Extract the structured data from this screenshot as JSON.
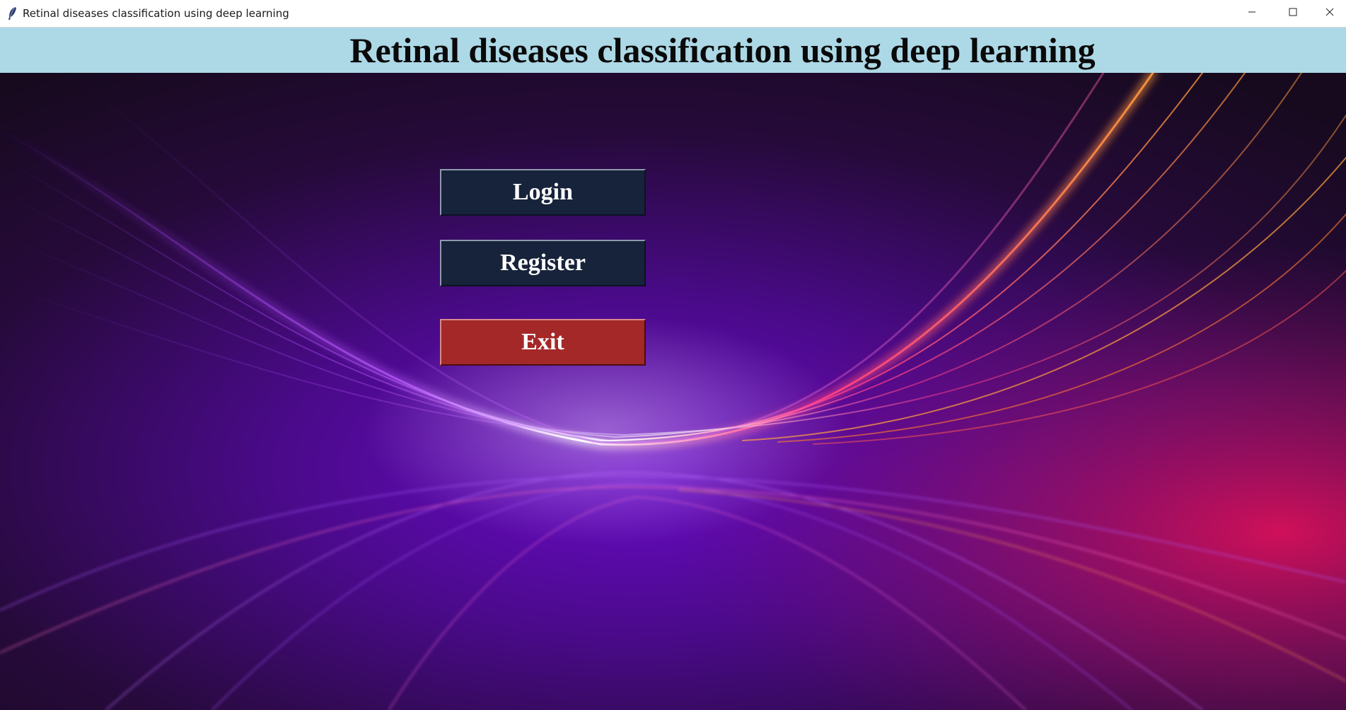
{
  "window": {
    "title": "Retinal diseases classification using deep learning",
    "app_icon": "feather-icon",
    "controls": {
      "minimize_icon": "minimize-icon",
      "maximize_icon": "maximize-icon",
      "close_icon": "close-icon"
    }
  },
  "header": {
    "title": "Retinal diseases classification using deep learning",
    "background_color": "#add8e6"
  },
  "menu": {
    "login_label": "Login",
    "register_label": "Register",
    "exit_label": "Exit",
    "button_color": "#17233a",
    "exit_color": "#a42828"
  }
}
